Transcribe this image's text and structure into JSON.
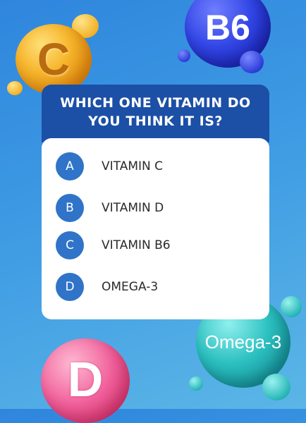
{
  "quiz": {
    "question": "WHICH ONE VITAMIN DO YOU THINK IT IS?",
    "options": [
      {
        "letter": "A",
        "text": "VITAMIN C"
      },
      {
        "letter": "B",
        "text": "VITAMIN D"
      },
      {
        "letter": "C",
        "text": "VITAMIN B6"
      },
      {
        "letter": "D",
        "text": "OMEGA-3"
      }
    ]
  },
  "decor": {
    "vitamin_c_label": "C",
    "vitamin_b6_label": "B6",
    "vitamin_d_label": "D",
    "omega_label": "Omega-3"
  },
  "colors": {
    "background": "#3e9ae3",
    "header": "#1c4fa6",
    "option_circle": "#2f74c8",
    "vitamin_c": "#f6b52c",
    "vitamin_b6": "#3347e6",
    "omega": "#2cc0c0",
    "vitamin_d": "#f05f9a"
  }
}
